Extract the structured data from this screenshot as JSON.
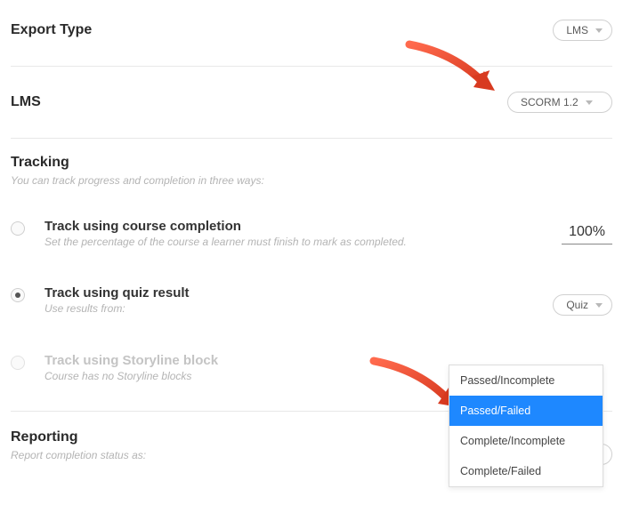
{
  "exportType": {
    "label": "Export Type",
    "value": "LMS"
  },
  "lms": {
    "label": "LMS",
    "value": "SCORM 1.2"
  },
  "tracking": {
    "label": "Tracking",
    "subtitle": "You can track progress and completion in three ways:",
    "options": [
      {
        "title": "Track using course completion",
        "sub": "Set the percentage of the course a learner must finish to mark as completed.",
        "percent": "100%"
      },
      {
        "title": "Track using quiz result",
        "sub": "Use results from:",
        "quizValue": "Quiz"
      },
      {
        "title": "Track using Storyline block",
        "sub": "Course has no Storyline blocks"
      }
    ]
  },
  "reporting": {
    "label": "Reporting",
    "subtitle": "Report completion status as:",
    "value": "Passed/Failed",
    "menu": [
      "Passed/Incomplete",
      "Passed/Failed",
      "Complete/Incomplete",
      "Complete/Failed"
    ]
  }
}
